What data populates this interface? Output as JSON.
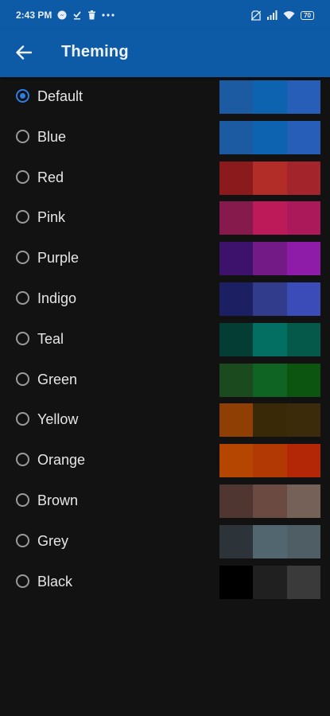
{
  "status_bar": {
    "time": "2:43 PM",
    "left_icons": [
      "messenger-icon",
      "download-done-icon",
      "trash-icon",
      "more-dots-icon"
    ],
    "right_icons": [
      "no-sim-icon",
      "signal-icon",
      "wifi-icon"
    ],
    "battery": "70"
  },
  "app_bar": {
    "title": "Theming",
    "back_icon": "arrow-back-icon",
    "background": "#0d5aa7"
  },
  "themes": [
    {
      "label": "Default",
      "selected": true,
      "colors": [
        "#1c5ba1",
        "#0e63b1",
        "#275eb8"
      ]
    },
    {
      "label": "Blue",
      "selected": false,
      "colors": [
        "#1c5ba1",
        "#0e63b1",
        "#275eb8"
      ]
    },
    {
      "label": "Red",
      "selected": false,
      "colors": [
        "#8a1a1b",
        "#b22d28",
        "#a4242c"
      ]
    },
    {
      "label": "Pink",
      "selected": false,
      "colors": [
        "#871a4c",
        "#bd1a59",
        "#ab195a"
      ]
    },
    {
      "label": "Purple",
      "selected": false,
      "colors": [
        "#3d126d",
        "#741a86",
        "#8f1ca8"
      ]
    },
    {
      "label": "Indigo",
      "selected": false,
      "colors": [
        "#1c1f62",
        "#323c8d",
        "#3b4cb9"
      ]
    },
    {
      "label": "Teal",
      "selected": false,
      "colors": [
        "#033d34",
        "#036f63",
        "#04594a"
      ]
    },
    {
      "label": "Green",
      "selected": false,
      "colors": [
        "#1a4a1e",
        "#0f6424",
        "#0c5510"
      ]
    },
    {
      "label": "Yellow",
      "selected": false,
      "colors": [
        "#8f3f04",
        "#3a2907",
        "#3b2b0b"
      ]
    },
    {
      "label": "Orange",
      "selected": false,
      "colors": [
        "#b54602",
        "#b23904",
        "#b32606"
      ]
    },
    {
      "label": "Brown",
      "selected": false,
      "colors": [
        "#4f3630",
        "#6b4a41",
        "#756158"
      ]
    },
    {
      "label": "Grey",
      "selected": false,
      "colors": [
        "#2d3439",
        "#526670",
        "#4f5d64"
      ]
    },
    {
      "label": "Black",
      "selected": false,
      "colors": [
        "#000000",
        "#202020",
        "#3a3a3a"
      ]
    }
  ]
}
